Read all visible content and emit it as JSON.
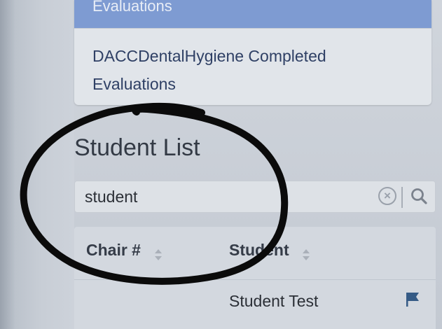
{
  "menu": {
    "active_item": "Evaluations",
    "item_line1": "DACCDentalHygiene Completed",
    "item_line2": "Evaluations"
  },
  "student_list": {
    "title": "Student List",
    "search": {
      "value": "student",
      "clear_icon": "clear-circle-icon",
      "search_icon": "magnifier-icon"
    },
    "table": {
      "columns": [
        "Chair #",
        "Student"
      ],
      "rows": [
        {
          "chair": "",
          "student": "Student Test",
          "flag_icon": "flag-icon"
        }
      ]
    }
  },
  "colors": {
    "active_menu": "#7e9bd2",
    "link_text": "#2f4065",
    "flag": "#355b86",
    "annotation_ink": "#0b0b0b"
  }
}
